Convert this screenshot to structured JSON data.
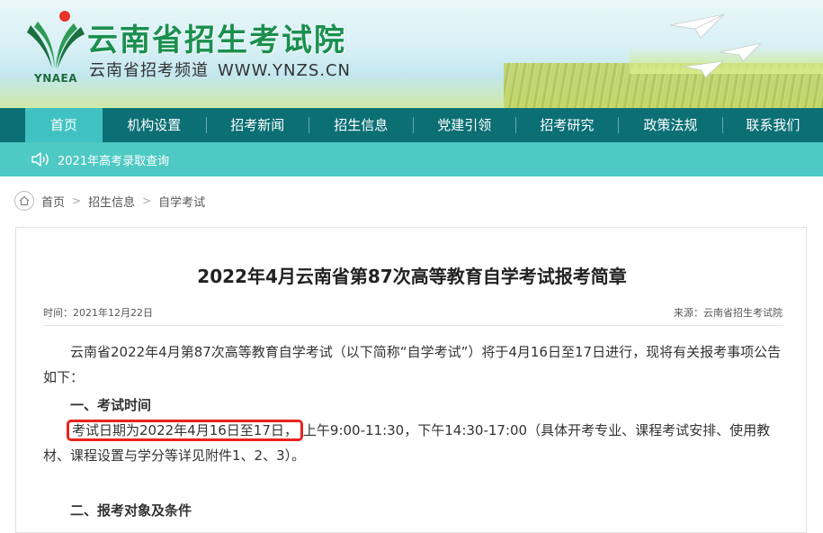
{
  "header": {
    "logo_abbr": "YNAEA",
    "site_title": "云南省招生考试院",
    "subtitle": "云南省招考频道",
    "url": "WWW.YNZS.CN"
  },
  "nav": {
    "items": [
      {
        "label": "首页",
        "active": true
      },
      {
        "label": "机构设置"
      },
      {
        "label": "招考新闻"
      },
      {
        "label": "招生信息"
      },
      {
        "label": "党建引领"
      },
      {
        "label": "招考研究"
      },
      {
        "label": "政策法规"
      },
      {
        "label": "联系我们"
      }
    ]
  },
  "notice": {
    "icon": "speaker-icon",
    "text": "2021年高考录取查询"
  },
  "breadcrumb": {
    "home": "首页",
    "level1": "招生信息",
    "level2": "自学考试",
    "separator": ">"
  },
  "article": {
    "title": "2022年4月云南省第87次高等教育自学考试报考简章",
    "time": "时间：2021年12月22日",
    "source": "来源：云南省招生考试院",
    "intro": "云南省2022年4月第87次高等教育自学考试（以下简称“自学考试”）将于4月16日至17日进行，现将有关报考事项公告如下：",
    "section1": "一、考试时间",
    "highlight": "考试日期为2022年4月16日至17日，",
    "rest": "上午9:00-11:30，下午14:30-17:00（具体开考专业、课程考试安排、使用教材、课程设置与学分等详见附件1、2、3）。",
    "section2": "二、报考对象及条件"
  },
  "colors": {
    "nav_bg": "#0b6f74",
    "nav_active": "#41c2c2",
    "notice_bg": "#4ec9c3",
    "title_green": "#1b8f4f",
    "highlight_border": "#e8231f"
  }
}
